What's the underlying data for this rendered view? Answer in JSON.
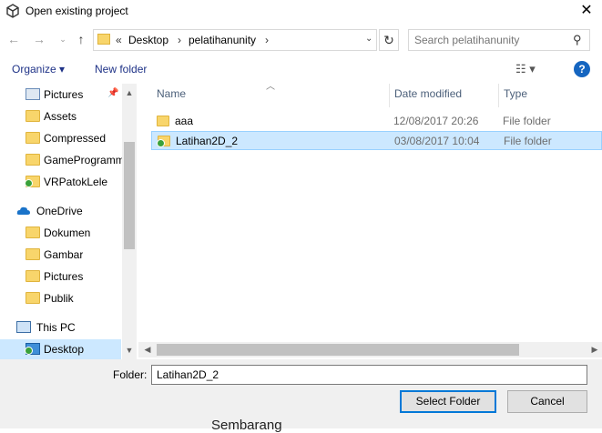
{
  "window": {
    "title": "Open existing project"
  },
  "nav": {
    "breadcrumb": [
      "Desktop",
      "pelatihanunity"
    ],
    "overflow": "«",
    "search_placeholder": "Search pelatihanunity"
  },
  "toolbar": {
    "organize": "Organize ▾",
    "new_folder": "New folder"
  },
  "sidebar": {
    "items": [
      {
        "label": "Pictures",
        "icon": "pictures-icon",
        "pinned": true
      },
      {
        "label": "Assets",
        "icon": "folder-icon"
      },
      {
        "label": "Compressed",
        "icon": "folder-icon"
      },
      {
        "label": "GameProgramm",
        "icon": "folder-icon"
      },
      {
        "label": "VRPatokLele",
        "icon": "synced-folder-icon"
      },
      {
        "label": "OneDrive",
        "icon": "onedrive-icon"
      },
      {
        "label": "Dokumen",
        "icon": "folder-icon"
      },
      {
        "label": "Gambar",
        "icon": "folder-icon"
      },
      {
        "label": "Pictures",
        "icon": "folder-icon"
      },
      {
        "label": "Publik",
        "icon": "folder-icon"
      },
      {
        "label": "This PC",
        "icon": "pc-icon"
      },
      {
        "label": "Desktop",
        "icon": "desktop-icon",
        "selected": true
      }
    ]
  },
  "list": {
    "columns": [
      "Name",
      "Date modified",
      "Type"
    ],
    "rows": [
      {
        "name": "aaa",
        "date": "12/08/2017 20:26",
        "type": "File folder"
      },
      {
        "name": "Latihan2D_2",
        "date": "03/08/2017 10:04",
        "type": "File folder",
        "selected": true
      }
    ]
  },
  "footer": {
    "folder_label": "Folder:",
    "folder_value": "Latihan2D_2",
    "select_button": "Select Folder",
    "cancel_button": "Cancel",
    "background_peek": "Sembarang"
  },
  "colors": {
    "accent": "#0078d7",
    "selection": "#cce8ff",
    "help": "#1565c0"
  }
}
